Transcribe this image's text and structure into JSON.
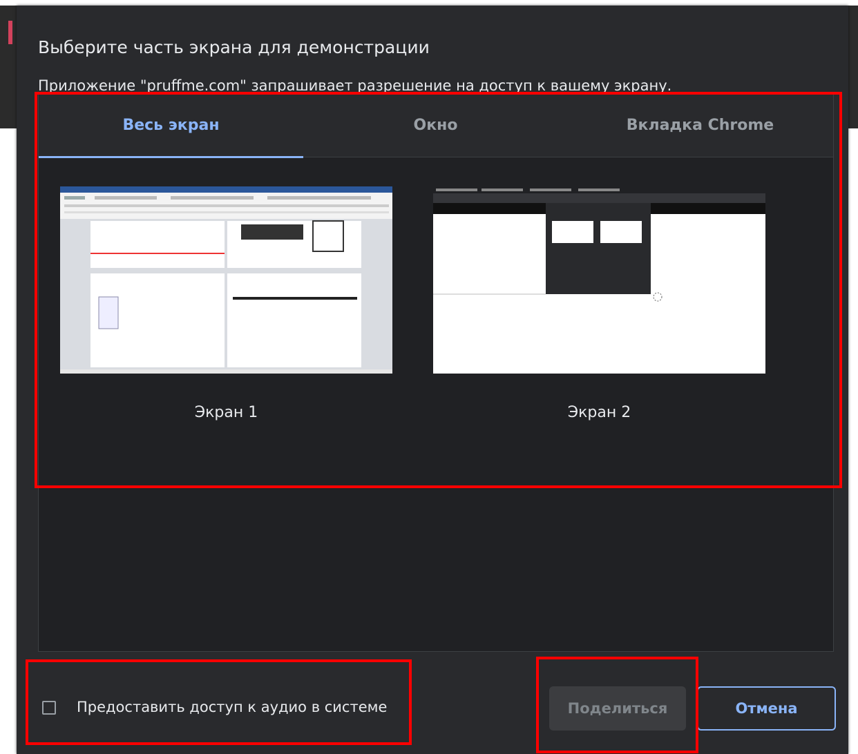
{
  "dialog": {
    "title": "Выберите часть экрана для демонстрации",
    "subtitle": "Приложение \"pruffme.com\" запрашивает разрешение на доступ к вашему экрану."
  },
  "tabs": [
    {
      "label": "Весь экран",
      "active": true
    },
    {
      "label": "Окно",
      "active": false
    },
    {
      "label": "Вкладка Chrome",
      "active": false
    }
  ],
  "screens": [
    {
      "label": "Экран 1"
    },
    {
      "label": "Экран 2"
    }
  ],
  "footer": {
    "audio_checkbox_label": "Предоставить доступ к аудио в системе",
    "audio_checked": false,
    "share_label": "Поделиться",
    "cancel_label": "Отмена"
  },
  "colors": {
    "accent": "#8ab4f8",
    "dialog_bg": "#292a2d",
    "annotation": "#ff0000"
  }
}
